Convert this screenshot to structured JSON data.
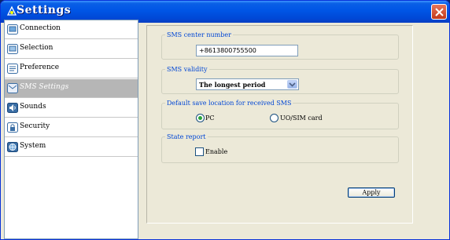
{
  "window": {
    "title": "Settings"
  },
  "sidebar": {
    "items": [
      {
        "label": "Connection",
        "icon": "connection-icon",
        "active": false
      },
      {
        "label": "Selection",
        "icon": "selection-icon",
        "active": false
      },
      {
        "label": "Preference",
        "icon": "preference-icon",
        "active": false
      },
      {
        "label": "SMS Settings",
        "icon": "sms-icon",
        "active": true
      },
      {
        "label": "Sounds",
        "icon": "speaker-icon",
        "active": false
      },
      {
        "label": "Security",
        "icon": "lock-icon",
        "active": false
      },
      {
        "label": "System",
        "icon": "globe-icon",
        "active": false
      }
    ]
  },
  "sms": {
    "center_legend": "SMS center number",
    "center_value": "+8613800755500",
    "validity_legend": "SMS validity",
    "validity_selected": "The longest period",
    "location_legend": "Default save location for received SMS",
    "option_pc": "PC",
    "option_uim": "UO/SIM card",
    "selected_location": "PC",
    "report_legend": "State report",
    "enable_label": "Enable",
    "enable_checked": false
  },
  "buttons": {
    "apply": "Apply"
  }
}
